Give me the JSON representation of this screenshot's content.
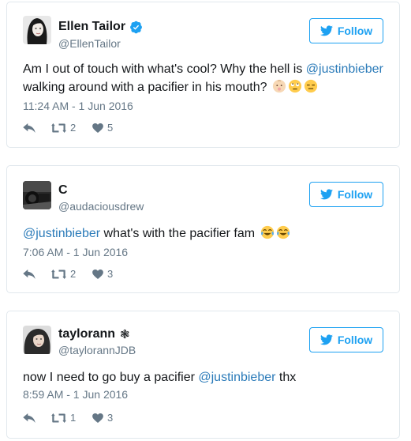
{
  "colors": {
    "accent": "#1da1f2",
    "mention": "#2b7bb9",
    "meta": "#657786",
    "border": "#e1e8ed"
  },
  "follow_label": "Follow",
  "tweets": [
    {
      "name": "Ellen Tailor",
      "verified": true,
      "handle": "@EllenTailor",
      "text_before": "Am I out of touch with what's cool? Why the hell is ",
      "mention": "@justinbieber",
      "text_after": " walking around with a pacifier in his mouth? ",
      "emojis": [
        "baby-face-emoji",
        "face-with-rolling-eyes-emoji",
        "expressionless-face-emoji"
      ],
      "time": "11:24 AM - 1 Jun 2016",
      "retweets": "2",
      "likes": "5"
    },
    {
      "name": "C",
      "verified": false,
      "handle": "@audaciousdrew",
      "text_before": "",
      "mention": "@justinbieber",
      "text_after": " what's with the pacifier fam ",
      "emojis": [
        "tears-of-joy-emoji",
        "tears-of-joy-emoji"
      ],
      "time": "7:06 AM - 1 Jun 2016",
      "retweets": "2",
      "likes": "3"
    },
    {
      "name": "taylorann",
      "flair": "❃",
      "verified": false,
      "handle": "@taylorannJDB",
      "text_before": "now I need to go buy a pacifier ",
      "mention": "@justinbieber",
      "text_after": " thx",
      "emojis": [],
      "time": "8:59 AM - 1 Jun 2016",
      "retweets": "1",
      "likes": "3"
    }
  ]
}
